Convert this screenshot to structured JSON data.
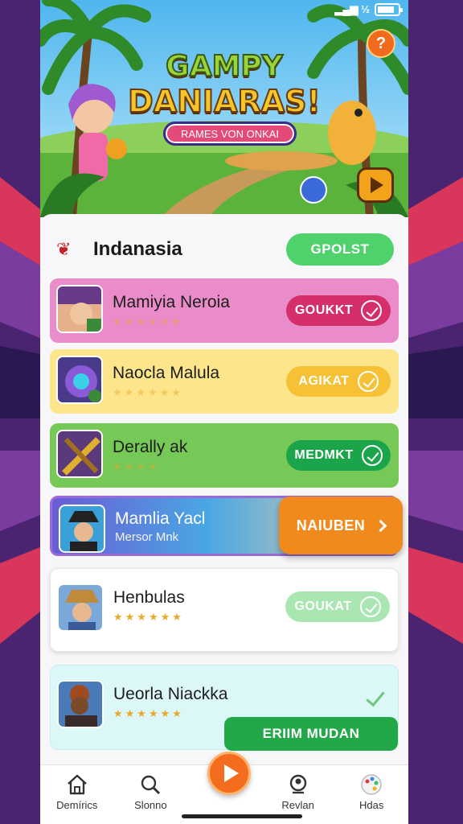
{
  "status": {
    "signal_text": "▂▄▆ ½"
  },
  "hero": {
    "title_line1": "GAMPY",
    "title_line2": "DANIARAS!",
    "subtitle": "RAMES VON ONKAI",
    "hint_icon": "?"
  },
  "panel": {
    "title": "Indanasia",
    "header_button": "GPOLST"
  },
  "games": [
    {
      "name": "Mamiyia Neroia",
      "sub": "",
      "button": "GOUKKT",
      "stars": "★★★★★★"
    },
    {
      "name": "Naocla Malula",
      "sub": "",
      "button": "AGIKAT",
      "stars": "★★★★★★"
    },
    {
      "name": "Derally ak",
      "sub": "",
      "button": "MEDMKT",
      "stars": "★★★★"
    },
    {
      "name": "Mamlia Yacl",
      "sub": "Mersor Mnk",
      "button": "NAIUBEN",
      "stars": ""
    },
    {
      "name": "Henbulas",
      "sub": "",
      "button": "GOUKAT",
      "stars": "★★★★★★"
    },
    {
      "name": "Ueorla Niackka",
      "sub": "",
      "button": "ERIIM MUDAN",
      "stars": "★★★★★★"
    }
  ],
  "nav": [
    {
      "label": "Demírics",
      "icon": "home-icon"
    },
    {
      "label": "Slonno",
      "icon": "search-icon"
    },
    {
      "label": "Revlan",
      "icon": "profile-icon"
    },
    {
      "label": "Hdas",
      "icon": "palette-icon"
    }
  ],
  "colors": {
    "accent": "#f46d1e",
    "green": "#23a849",
    "pink": "#d52f6b"
  }
}
